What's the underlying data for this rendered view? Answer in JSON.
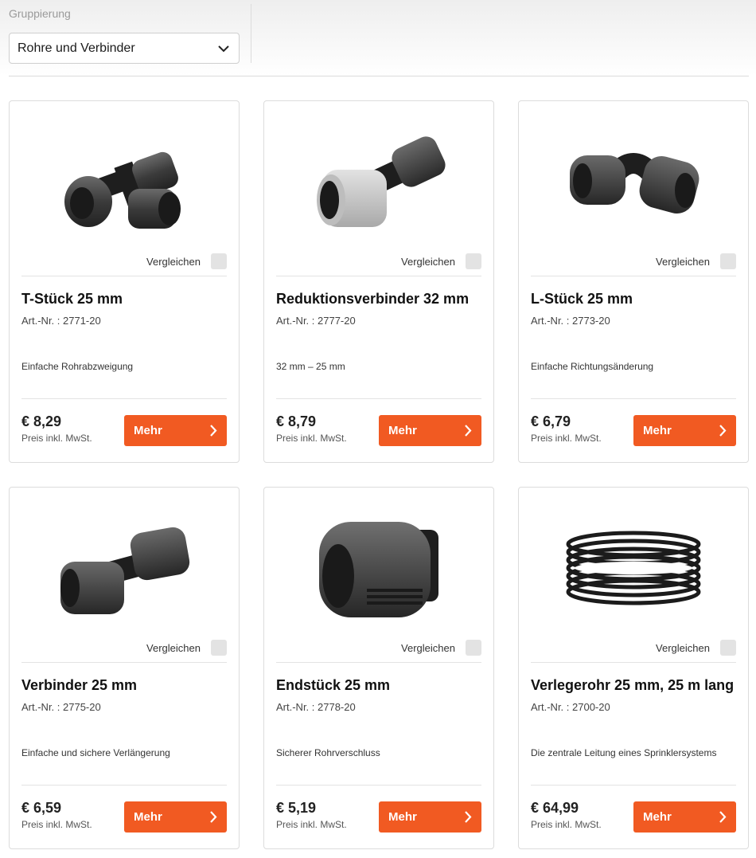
{
  "filter": {
    "label": "Gruppierung",
    "selected": "Rohre und Verbinder"
  },
  "products": [
    {
      "title": "T-Stück 25 mm",
      "artnr": "Art.-Nr. : 2771-20",
      "desc": "Einfache Rohrabzweigung",
      "price": "€ 8,29",
      "price_note": "Preis inkl. MwSt.",
      "compare": "Vergleichen",
      "button": "Mehr",
      "image": "t-piece-image"
    },
    {
      "title": "Reduktionsverbinder 32 mm",
      "artnr": "Art.-Nr. : 2777-20",
      "desc": "32 mm – 25 mm",
      "price": "€ 8,79",
      "price_note": "Preis inkl. MwSt.",
      "compare": "Vergleichen",
      "button": "Mehr",
      "image": "reducer-image"
    },
    {
      "title": "L-Stück 25 mm",
      "artnr": "Art.-Nr. : 2773-20",
      "desc": "Einfache Richtungsänderung",
      "price": "€ 6,79",
      "price_note": "Preis inkl. MwSt.",
      "compare": "Vergleichen",
      "button": "Mehr",
      "image": "elbow-image"
    },
    {
      "title": "Verbinder 25 mm",
      "artnr": "Art.-Nr. : 2775-20",
      "desc": "Einfache und sichere Verlängerung",
      "price": "€ 6,59",
      "price_note": "Preis inkl. MwSt.",
      "compare": "Vergleichen",
      "button": "Mehr",
      "image": "connector-image"
    },
    {
      "title": "Endstück 25 mm",
      "artnr": "Art.-Nr. : 2778-20",
      "desc": "Sicherer Rohrverschluss",
      "price": "€ 5,19",
      "price_note": "Preis inkl. MwSt.",
      "compare": "Vergleichen",
      "button": "Mehr",
      "image": "end-cap-image"
    },
    {
      "title": "Verlegerohr 25 mm, 25 m lang",
      "artnr": "Art.-Nr. : 2700-20",
      "desc": "Die zentrale Leitung eines Sprinklersystems",
      "price": "€ 64,99",
      "price_note": "Preis inkl. MwSt.",
      "compare": "Vergleichen",
      "button": "Mehr",
      "image": "pipe-coil-image"
    }
  ],
  "colors": {
    "accent": "#f15a22",
    "border": "#dcdcdc",
    "checkbox": "#e3e3e3"
  }
}
